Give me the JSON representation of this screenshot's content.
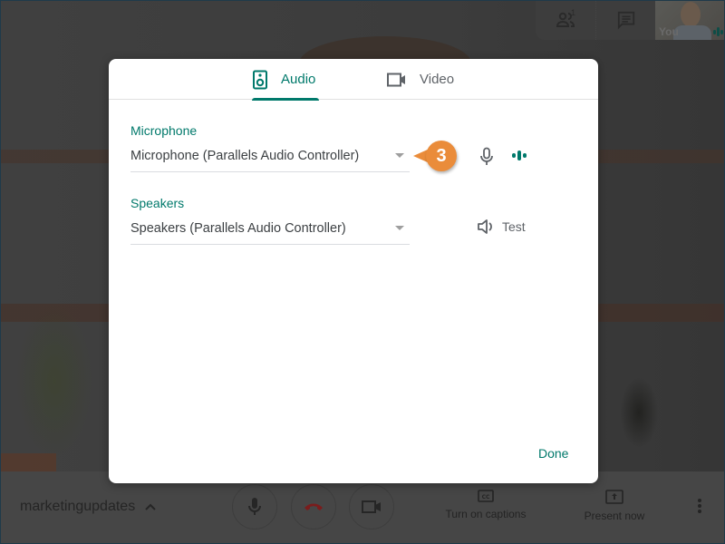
{
  "top_panel": {
    "people_count": "1",
    "self_label": "You"
  },
  "dialog": {
    "tabs": [
      {
        "label": "Audio",
        "icon": "speaker-icon",
        "selected": true
      },
      {
        "label": "Video",
        "icon": "videocam-icon",
        "selected": false
      }
    ],
    "microphone": {
      "label": "Microphone",
      "selected_value": "Microphone (Parallels Audio Controller)"
    },
    "speakers": {
      "label": "Speakers",
      "selected_value": "Speakers (Parallels Audio Controller)",
      "test_label": "Test"
    },
    "done_label": "Done"
  },
  "callout": {
    "step_number": "3"
  },
  "bottom_bar": {
    "meeting_name": "marketingupdates",
    "captions_label": "Turn on captions",
    "present_label": "Present now"
  },
  "colors": {
    "accent": "#00796b",
    "callout": "#ea8c3a",
    "hangup": "#8b1e1e"
  }
}
